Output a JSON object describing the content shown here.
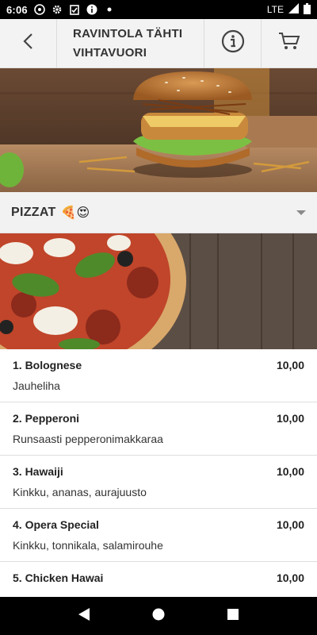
{
  "status_bar": {
    "time": "6:06",
    "network": "LTE"
  },
  "header": {
    "title_line1": "RAVINTOLA TÄHTI",
    "title_line2": "VIHTAVUORI",
    "icons": [
      "back-arrow-icon",
      "info-icon",
      "cart-icon"
    ]
  },
  "category": {
    "label": "PIZZAT",
    "emoji": "🍕😍"
  },
  "menu": {
    "items": [
      {
        "name": "1. Bolognese",
        "price": "10,00",
        "desc": "Jauheliha"
      },
      {
        "name": "2. Pepperoni",
        "price": "10,00",
        "desc": "Runsaasti pepperonimakkaraa"
      },
      {
        "name": "3. Hawaiji",
        "price": "10,00",
        "desc": "Kinkku, ananas, aurajuusto"
      },
      {
        "name": "4. Opera Special",
        "price": "10,00",
        "desc": "Kinkku, tonnikala, salamirouhe"
      },
      {
        "name": "5. Chicken Hawai",
        "price": "10,00",
        "desc": ""
      }
    ]
  },
  "colors": {
    "app_bar_bg": "#f3f3f3",
    "category_bg": "#f2f2f2",
    "system_bars": "#000000"
  }
}
